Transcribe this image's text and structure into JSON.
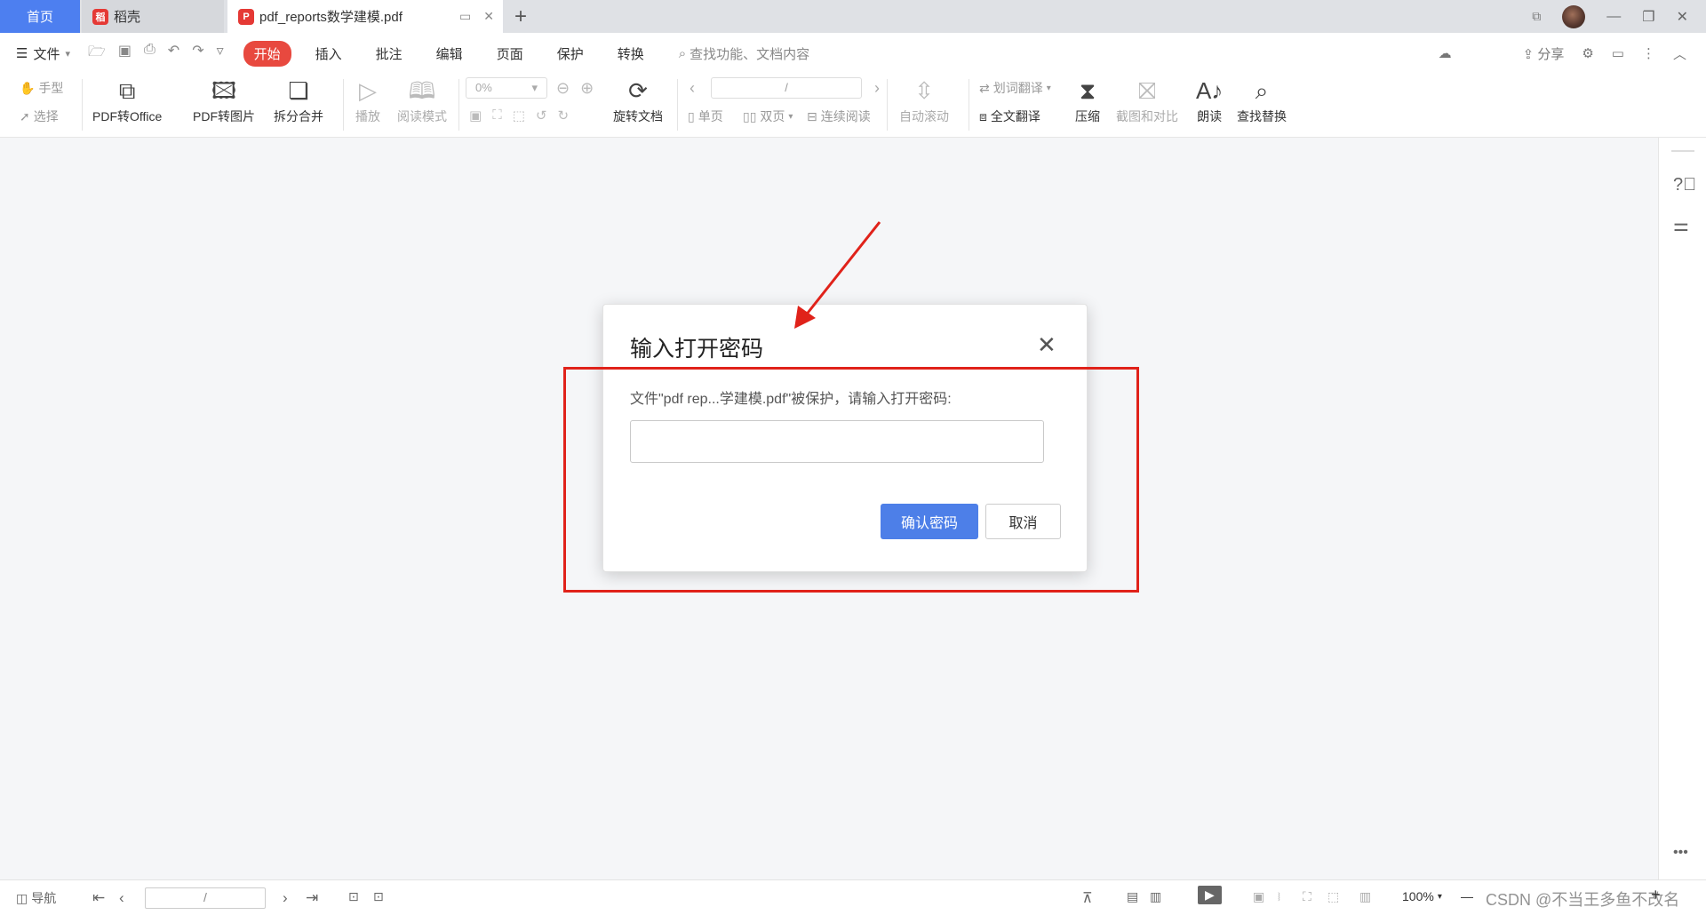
{
  "tabs": {
    "home": "首页",
    "daoke": "稻壳",
    "document": "pdf_reports数学建模.pdf"
  },
  "menu": {
    "file": "文件",
    "items": [
      "开始",
      "插入",
      "批注",
      "编辑",
      "页面",
      "保护",
      "转换"
    ],
    "search_placeholder": "查找功能、文档内容",
    "share": "分享"
  },
  "ribbon": {
    "hand": "手型",
    "select": "选择",
    "pdf_to_office": "PDF转Office",
    "pdf_to_image": "PDF转图片",
    "split_merge": "拆分合并",
    "play": "播放",
    "read_mode": "阅读模式",
    "zoom_value": "0%",
    "rotate_doc": "旋转文档",
    "page_field": "/",
    "single_page": "单页",
    "double_page": "双页",
    "continuous": "连续阅读",
    "auto_scroll": "自动滚动",
    "word_translate": "划词翻译",
    "full_translate": "全文翻译",
    "compress": "压缩",
    "screenshot_compare": "截图和对比",
    "read_aloud": "朗读",
    "find_replace": "查找替换"
  },
  "dialog": {
    "title": "输入打开密码",
    "message": "文件\"pdf rep...学建模.pdf\"被保护，请输入打开密码:",
    "password_value": "",
    "confirm": "确认密码",
    "cancel": "取消"
  },
  "statusbar": {
    "nav": "导航",
    "page_field": "/",
    "zoom": "100%",
    "watermark": "CSDN @不当王多鱼不改名"
  },
  "colors": {
    "accent_blue": "#4d7fe8",
    "active_tab_red": "#e8493f",
    "annotation_red": "#e0221a"
  }
}
